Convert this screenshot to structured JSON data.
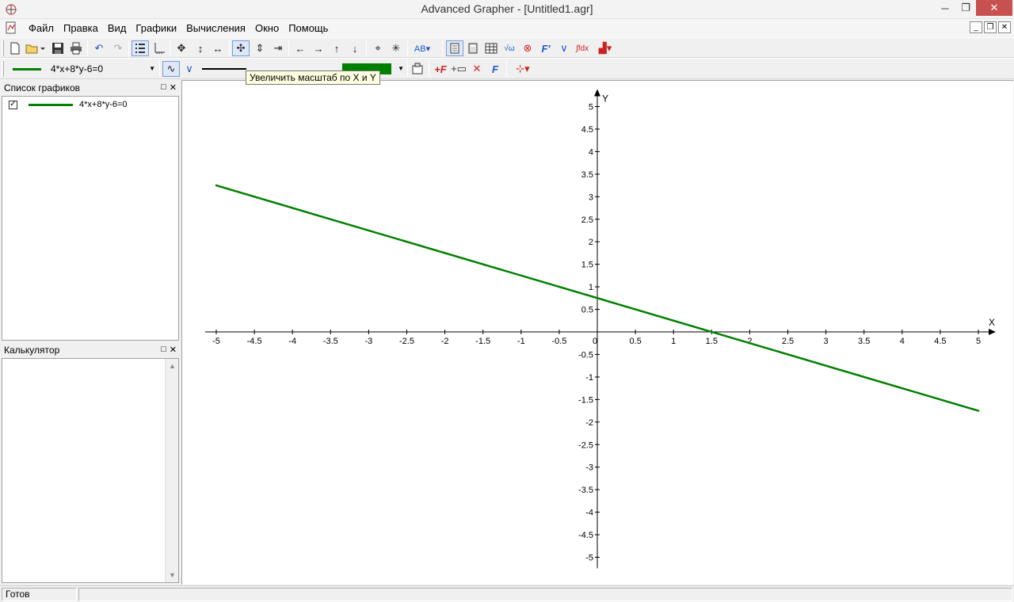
{
  "window": {
    "title": "Advanced Grapher - [Untitled1.agr]",
    "minimize_glyph": "─",
    "maximize_glyph": "❐",
    "close_glyph": "✕"
  },
  "menu": [
    "Файл",
    "Правка",
    "Вид",
    "Графики",
    "Вычисления",
    "Окно",
    "Помощь"
  ],
  "mdi_controls": [
    "_",
    "❐",
    "✕"
  ],
  "toolbar2": {
    "graph_combo_value": "4*x+8*y-6=0",
    "color_hex": "#008000"
  },
  "tooltip": "Увеличить масштаб по X и Y",
  "panels": {
    "graphs_title": "Список графиков",
    "calculator_title": "Калькулятор",
    "graph_items": [
      {
        "label": "4*x+8*y-6=0",
        "checked": true,
        "color": "#008000"
      }
    ]
  },
  "status": {
    "text": "Готов"
  },
  "icons": {
    "new": "new-file-icon",
    "open": "open-icon",
    "save": "save-icon",
    "print": "print-icon",
    "undo": "undo-icon",
    "redo": "redo-icon"
  },
  "chart_data": {
    "type": "line",
    "equation": "4*x+8*y-6=0",
    "xlim": [
      -5,
      5
    ],
    "ylim": [
      -5,
      5
    ],
    "x_ticks": [
      "-5",
      "-4.5",
      "-4",
      "-3.5",
      "-3",
      "-2.5",
      "-2",
      "-1.5",
      "-1",
      "-0.5",
      "0",
      "0.5",
      "1",
      "1.5",
      "2",
      "2.5",
      "3",
      "3.5",
      "4",
      "4.5",
      "5"
    ],
    "y_ticks": [
      "5",
      "4.5",
      "4",
      "3.5",
      "3",
      "2.5",
      "2",
      "1.5",
      "1",
      "0.5",
      "-0.5",
      "-1",
      "-1.5",
      "-2",
      "-2.5",
      "-3",
      "-3.5",
      "-4",
      "-4.5",
      "-5"
    ],
    "xlabel": "X",
    "ylabel": "Y",
    "series": [
      {
        "name": "4*x+8*y-6=0",
        "color": "#008000",
        "x": [
          -5,
          5
        ],
        "y": [
          3.25,
          -1.75
        ]
      }
    ],
    "grid": false
  }
}
